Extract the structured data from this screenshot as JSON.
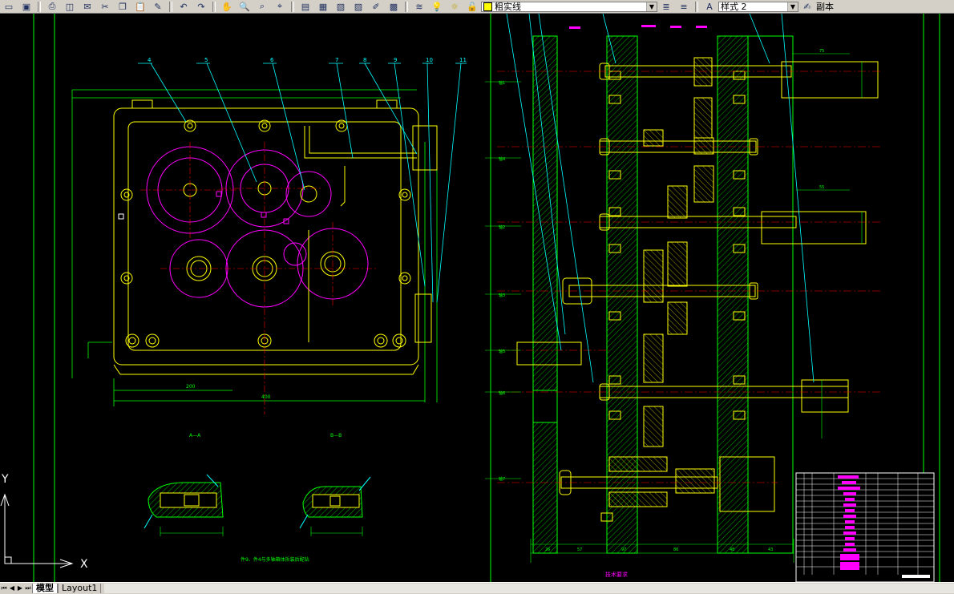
{
  "toolbar": {
    "linetype_combo": "粗实线",
    "style_combo": "样式 2",
    "copy_label": "副本"
  },
  "drawing": {
    "balloons": [
      "4",
      "5",
      "6",
      "7",
      "8",
      "9",
      "10",
      "11"
    ],
    "section_labels": [
      "A—A",
      "B—B"
    ],
    "dims": [
      "200",
      "400",
      "57",
      "97",
      "86",
      "48",
      "43",
      "75",
      "55",
      "26",
      "34",
      "63"
    ],
    "note": "件9、件4与多轴箱体拆装后配钻",
    "tech_title": "技术要求",
    "shaft_labels": [
      "轴1",
      "轴4",
      "轴2",
      "轴3",
      "轴5",
      "轴6",
      "轴7"
    ],
    "ucs_x": "X",
    "ucs_y": "Y"
  },
  "colors": {
    "yellow": "#ffff00",
    "cyan": "#00ffff",
    "green": "#00ff00",
    "magenta": "#ff00ff",
    "white": "#ffffff",
    "red": "#ff0000"
  },
  "statusbar": {
    "tab_model": "模型",
    "tab_layout": "Layout1"
  },
  "icons": [
    "new-icon",
    "save-icon",
    "print-icon",
    "preview-icon",
    "publish-icon",
    "cut-icon",
    "copy-icon",
    "paste-icon",
    "match-icon",
    "undo-icon",
    "redo-icon",
    "pan-icon",
    "zoom-icon",
    "zoom-window-icon",
    "zoom-prev-icon",
    "properties-icon",
    "design-center-icon",
    "tool-palette-icon",
    "sheet-set-icon",
    "markup-icon",
    "calc-icon",
    "layer-icon",
    "bulb-icon",
    "sun-icon",
    "lock-icon",
    "color-icon"
  ]
}
